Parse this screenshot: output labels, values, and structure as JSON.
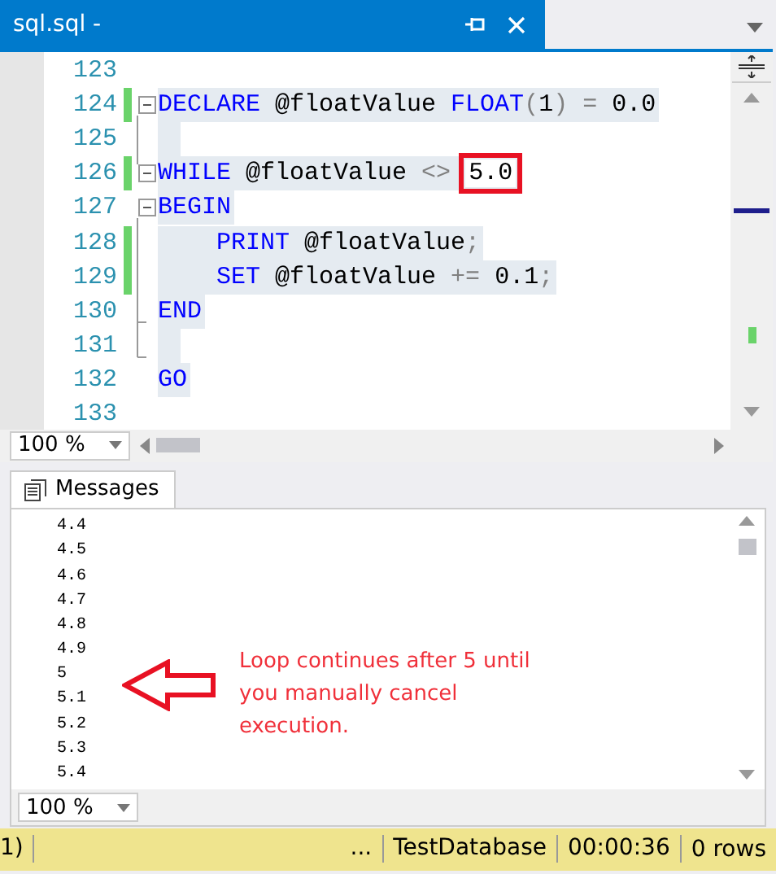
{
  "document_tab": {
    "title": "sql.sql -"
  },
  "code_lines": [
    {
      "number": "123",
      "changed": false,
      "collapsible": false,
      "selected": false
    },
    {
      "number": "124",
      "changed": true,
      "collapsible": true,
      "selected": true,
      "tokens": [
        {
          "kind": "keyword",
          "text": "DECLARE"
        },
        {
          "kind": "plain",
          "text": " @floatValue "
        },
        {
          "kind": "keyword",
          "text": "FLOAT"
        },
        {
          "kind": "operator",
          "text": "("
        },
        {
          "kind": "plain",
          "text": "1"
        },
        {
          "kind": "operator",
          "text": ")"
        },
        {
          "kind": "operator",
          "text": " ="
        },
        {
          "kind": "plain",
          "text": " 0.0"
        }
      ]
    },
    {
      "number": "125",
      "changed": false,
      "collapsible": false,
      "selected": true
    },
    {
      "number": "126",
      "changed": true,
      "collapsible": true,
      "selected": true,
      "tokens": [
        {
          "kind": "keyword",
          "text": "WHILE"
        },
        {
          "kind": "plain",
          "text": " @floatValue "
        },
        {
          "kind": "operator",
          "text": "<>"
        },
        {
          "kind": "boxed",
          "text": "5.0"
        }
      ]
    },
    {
      "number": "127",
      "changed": false,
      "collapsible": true,
      "selected": true,
      "tokens": [
        {
          "kind": "keyword",
          "text": "BEGIN"
        }
      ]
    },
    {
      "number": "128",
      "changed": true,
      "collapsible": false,
      "selected": true,
      "indent": true,
      "tokens": [
        {
          "kind": "keyword",
          "text": "PRINT"
        },
        {
          "kind": "plain",
          "text": " @floatValue"
        },
        {
          "kind": "operator",
          "text": ";"
        }
      ]
    },
    {
      "number": "129",
      "changed": true,
      "collapsible": false,
      "selected": true,
      "indent": true,
      "tokens": [
        {
          "kind": "keyword",
          "text": "SET"
        },
        {
          "kind": "plain",
          "text": " @floatValue "
        },
        {
          "kind": "operator",
          "text": "+="
        },
        {
          "kind": "plain",
          "text": " 0.1"
        },
        {
          "kind": "operator",
          "text": ";"
        }
      ]
    },
    {
      "number": "130",
      "changed": false,
      "collapsible": false,
      "selected": true,
      "tokens": [
        {
          "kind": "keyword",
          "text": "END"
        }
      ]
    },
    {
      "number": "131",
      "changed": false,
      "collapsible": false,
      "selected": true
    },
    {
      "number": "132",
      "changed": false,
      "collapsible": false,
      "selected": true,
      "tokens": [
        {
          "kind": "keyword",
          "text": "GO"
        }
      ]
    },
    {
      "number": "133",
      "changed": false,
      "collapsible": false,
      "selected": false
    }
  ],
  "editor_zoom": "100 %",
  "results_tab": {
    "label": "Messages"
  },
  "messages": [
    "4.4",
    "4.5",
    "4.6",
    "4.7",
    "4.8",
    "4.9",
    "5",
    "5.1",
    "5.2",
    "5.3",
    "5.4"
  ],
  "annotation": "Loop continues after 5 until you manually cancel execution.",
  "results_zoom": "100 %",
  "status_bar": {
    "left": "1)",
    "ellipsis": "...",
    "database": "TestDatabase",
    "elapsed": "00:00:36",
    "rows": "0 rows"
  }
}
